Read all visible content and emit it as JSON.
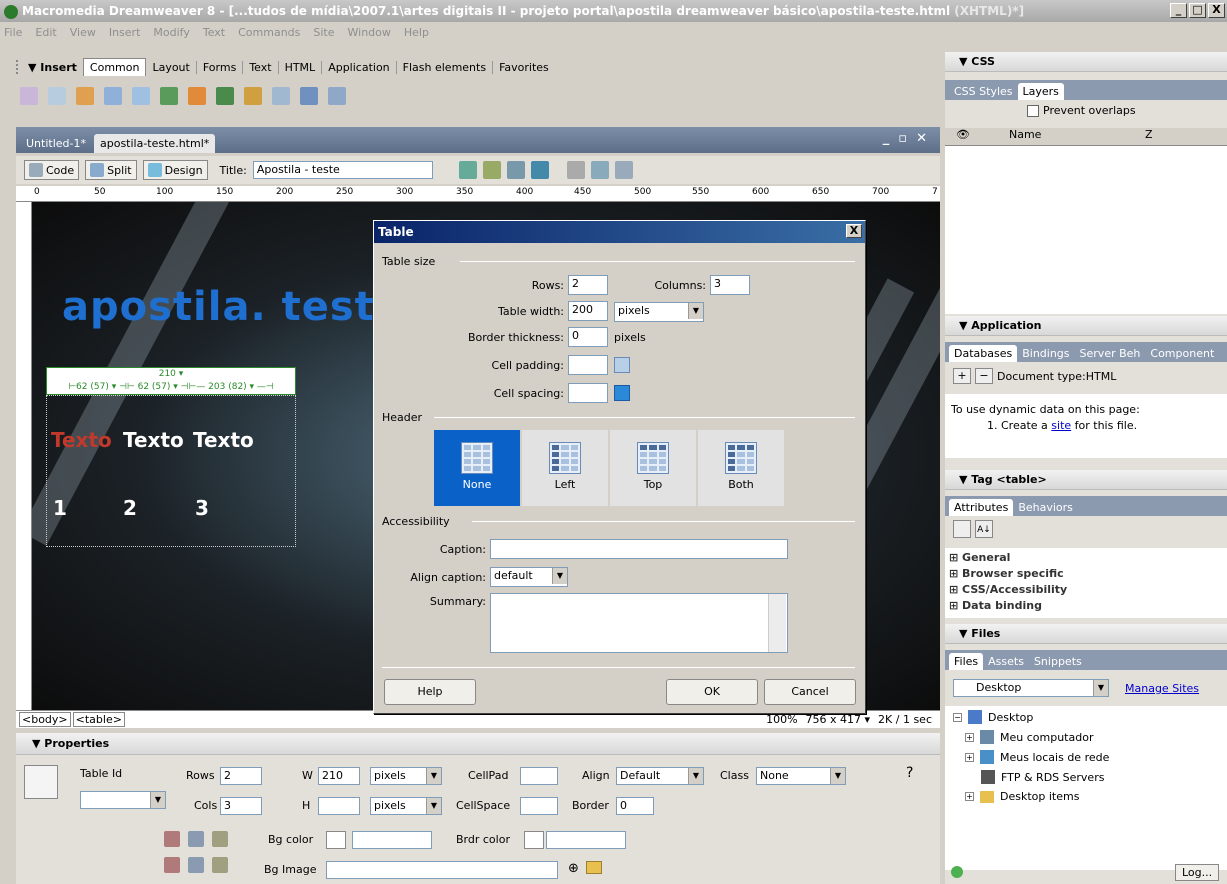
{
  "window": {
    "title_prefix": "Macromedia Dreamweaver 8 - [...tudos de mídia\\2007.1\\artes digitais II - projeto portal\\apostila dreamweaver básico\\apostila-teste.html",
    "title_suffix": " (XHTML)*]",
    "controls": [
      "_",
      "□",
      "X"
    ]
  },
  "menu": [
    "File",
    "Edit",
    "View",
    "Insert",
    "Modify",
    "Text",
    "Commands",
    "Site",
    "Window",
    "Help"
  ],
  "insert_bar": {
    "label": "▼ Insert",
    "tabs": [
      "Common",
      "Layout",
      "Forms",
      "Text",
      "HTML",
      "Application",
      "Flash elements",
      "Favorites"
    ]
  },
  "document": {
    "tabs": [
      "Untitled-1*",
      "apostila-teste.html*"
    ],
    "view_buttons": [
      "Code",
      "Split",
      "Design"
    ],
    "title_label": "Title:",
    "title_value": "Apostila - teste",
    "ruler_marks": [
      "0",
      "50",
      "100",
      "150",
      "200",
      "250",
      "300",
      "350",
      "400",
      "450",
      "500",
      "550",
      "600",
      "650",
      "700",
      "7"
    ],
    "heading": "apostila. teste",
    "table_width_label": "210 ▾",
    "table_col_widths": "⊢62 (57) ▾ ⊣⊢ 62 (57) ▾ ⊣⊢— 203 (82) ▾ —⊣",
    "row1": [
      "Texto",
      "Texto",
      "Texto"
    ],
    "row2": [
      "1",
      "2",
      "3"
    ],
    "tag_selector": [
      "<body>",
      "<table>"
    ],
    "zoom": "100%",
    "size": "756 x 417 ▾",
    "download": "2K / 1 sec"
  },
  "dialog": {
    "title": "Table",
    "close": "X",
    "section_size": "Table size",
    "rows_label": "Rows:",
    "rows_value": "2",
    "columns_label": "Columns:",
    "columns_value": "3",
    "width_label": "Table width:",
    "width_value": "200",
    "width_unit": "pixels",
    "border_label": "Border thickness:",
    "border_value": "0",
    "border_unit": "pixels",
    "padding_label": "Cell padding:",
    "spacing_label": "Cell spacing:",
    "section_header": "Header",
    "header_options": [
      "None",
      "Left",
      "Top",
      "Both"
    ],
    "section_access": "Accessibility",
    "caption_label": "Caption:",
    "align_label": "Align caption:",
    "align_value": "default",
    "summary_label": "Summary:",
    "help": "Help",
    "ok": "OK",
    "cancel": "Cancel"
  },
  "properties": {
    "header": "▼ Properties",
    "table_id_label": "Table Id",
    "rows_label": "Rows",
    "rows_value": "2",
    "cols_label": "Cols",
    "cols_value": "3",
    "w_label": "W",
    "w_value": "210",
    "w_unit": "pixels",
    "h_label": "H",
    "h_unit": "pixels",
    "cellpad_label": "CellPad",
    "cellspace_label": "CellSpace",
    "align_label": "Align",
    "align_value": "Default",
    "border_label": "Border",
    "border_value": "0",
    "class_label": "Class",
    "class_value": "None",
    "bgcolor_label": "Bg color",
    "brdrcolor_label": "Brdr color",
    "bgimage_label": "Bg Image"
  },
  "css_panel": {
    "header": "▼ CSS",
    "tabs": [
      "CSS Styles",
      "Layers"
    ],
    "prevent": "Prevent overlaps",
    "cols": [
      "Name",
      "Z"
    ]
  },
  "app_panel": {
    "header": "▼ Application",
    "tabs": [
      "Databases",
      "Bindings",
      "Server Beh",
      "Component"
    ],
    "doctype": "Document type:HTML",
    "info1": "To use dynamic data on this page:",
    "info2_pre": "1. Create a ",
    "info2_link": "site",
    "info2_post": " for this file."
  },
  "tag_panel": {
    "header": "▼ Tag <table>",
    "tabs": [
      "Attributes",
      "Behaviors"
    ],
    "groups": [
      "General",
      "Browser specific",
      "CSS/Accessibility",
      "Data binding"
    ]
  },
  "files_panel": {
    "header": "▼ Files",
    "tabs": [
      "Files",
      "Assets",
      "Snippets"
    ],
    "location": "Desktop",
    "manage": "Manage Sites",
    "tree": [
      "Desktop",
      "Meu computador",
      "Meus locais de rede",
      "FTP & RDS Servers",
      "Desktop items"
    ],
    "log": "Log..."
  },
  "colors": {
    "accent": "#0a246a",
    "heading": "#1e6fd0",
    "selected": "#0a62c8",
    "first_cell": "#c0392b"
  }
}
